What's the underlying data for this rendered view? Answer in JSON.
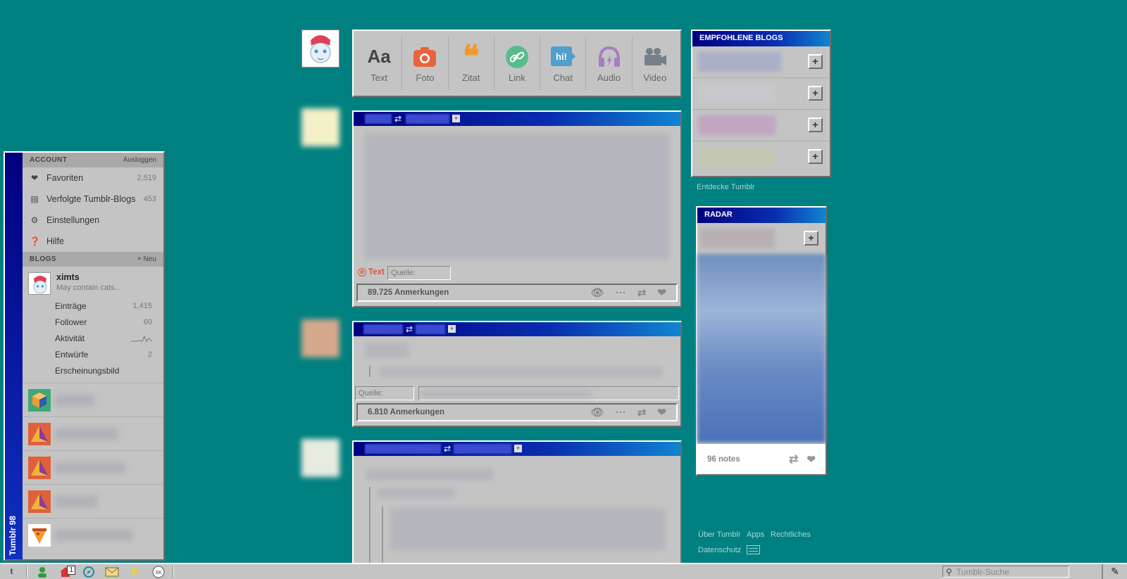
{
  "sidebar": {
    "brand": "Tumblr 98",
    "account_header": "ACCOUNT",
    "logout": "Ausloggen",
    "account_items": [
      {
        "label": "Favoriten",
        "count": "2,519",
        "icon": "heart-icon"
      },
      {
        "label": "Verfolgte Tumblr-Blogs",
        "count": "453",
        "icon": "contacts-icon"
      },
      {
        "label": "Einstellungen",
        "count": "",
        "icon": "gear-icon"
      },
      {
        "label": "Hilfe",
        "count": "",
        "icon": "help-icon"
      }
    ],
    "blogs_header": "BLOGS",
    "new_blog": "+ Neu",
    "primary_blog": {
      "name": "ximts",
      "description": "May contain cats..."
    },
    "blog_items": [
      {
        "label": "Einträge",
        "count": "1,415"
      },
      {
        "label": "Follower",
        "count": "60"
      },
      {
        "label": "Aktivität",
        "count": ""
      },
      {
        "label": "Entwürfe",
        "count": "2"
      },
      {
        "label": "Erscheinungsbild",
        "count": ""
      }
    ]
  },
  "composer": {
    "types": [
      {
        "label": "Text",
        "glyph": "Aa",
        "color": "#444444"
      },
      {
        "label": "Foto",
        "glyph": "◉",
        "color": "#e8643c"
      },
      {
        "label": "Zitat",
        "glyph": "❝",
        "color": "#f2992e"
      },
      {
        "label": "Link",
        "glyph": "∞",
        "color": "#56bc8a"
      },
      {
        "label": "Chat",
        "glyph": "hi!",
        "color": "#529ecc"
      },
      {
        "label": "Audio",
        "glyph": "🎧",
        "color": "#a77dc2"
      },
      {
        "label": "Video",
        "glyph": "🎥",
        "color": "#748089"
      }
    ]
  },
  "posts": [
    {
      "type_label": "Text",
      "source_label": "Quelle:",
      "notes": "89.725 Anmerkungen"
    },
    {
      "source_label": "Quelle:",
      "notes": "6.810 Anmerkungen"
    }
  ],
  "recommended": {
    "title": "EMPFOHLENE BLOGS",
    "plus": "+",
    "discover": "Entdecke Tumblr"
  },
  "radar": {
    "title": "RADAR",
    "plus": "+",
    "notes": "96 notes"
  },
  "footer_links": {
    "about": "Über Tumblr",
    "apps": "Apps",
    "legal": "Rechtliches",
    "privacy": "Datenschutz"
  },
  "taskbar": {
    "inbox_badge": "1",
    "search_placeholder": "Tumblr-Suche"
  }
}
